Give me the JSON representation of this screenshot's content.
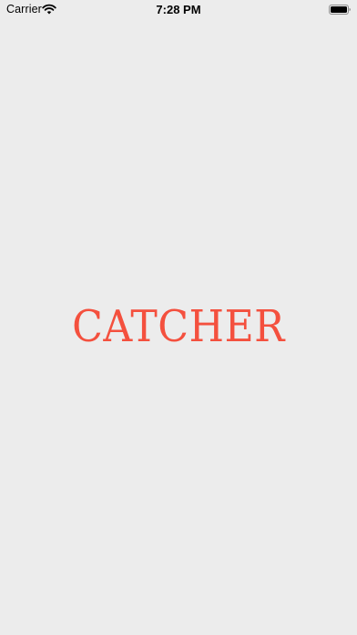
{
  "status_bar": {
    "carrier": "Carrier",
    "time": "7:28 PM",
    "wifi_icon": "wifi-icon",
    "battery_icon": "battery-full-icon"
  },
  "splash": {
    "brand_name": "CATCHER"
  },
  "colors": {
    "background": "#ececec",
    "brand": "#f4503e"
  }
}
